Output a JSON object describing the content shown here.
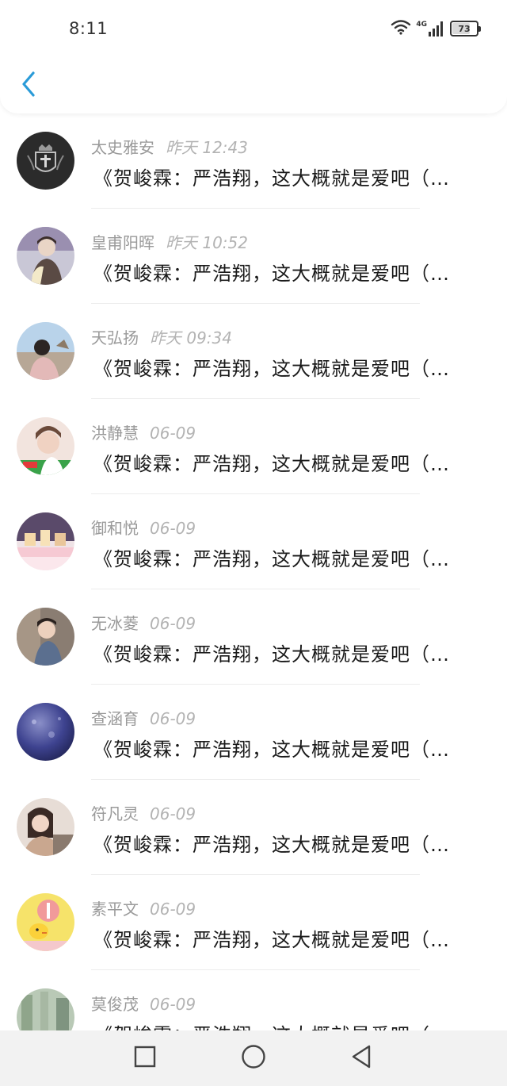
{
  "status_bar": {
    "time": "8:11",
    "network": "4G",
    "battery": "73"
  },
  "header": {
    "back_icon": "chevron-left-icon",
    "accent_color": "#2a9bd8"
  },
  "messages": [
    {
      "name": "太史雅安",
      "date": "昨天 12:43",
      "preview": "《贺峻霖：严浩翔，这大概就是爱吧（…"
    },
    {
      "name": "皇甫阳晖",
      "date": "昨天 10:52",
      "preview": "《贺峻霖：严浩翔，这大概就是爱吧（…"
    },
    {
      "name": "天弘扬",
      "date": "昨天 09:34",
      "preview": "《贺峻霖：严浩翔，这大概就是爱吧（…"
    },
    {
      "name": "洪静慧",
      "date": "06-09",
      "preview": "《贺峻霖：严浩翔，这大概就是爱吧（…"
    },
    {
      "name": "御和悦",
      "date": "06-09",
      "preview": "《贺峻霖：严浩翔，这大概就是爱吧（…"
    },
    {
      "name": "无冰菱",
      "date": "06-09",
      "preview": "《贺峻霖：严浩翔，这大概就是爱吧（…"
    },
    {
      "name": "查涵育",
      "date": "06-09",
      "preview": "《贺峻霖：严浩翔，这大概就是爱吧（…"
    },
    {
      "name": "符凡灵",
      "date": "06-09",
      "preview": "《贺峻霖：严浩翔，这大概就是爱吧（…"
    },
    {
      "name": "素平文",
      "date": "06-09",
      "preview": "《贺峻霖：严浩翔，这大概就是爱吧（…"
    },
    {
      "name": "莫俊茂",
      "date": "06-09",
      "preview": "《贺峻霖：严浩翔，这大概就是爱吧（…"
    }
  ],
  "nav": {
    "recents_icon": "square-icon",
    "home_icon": "circle-icon",
    "back_icon": "triangle-back-icon"
  }
}
